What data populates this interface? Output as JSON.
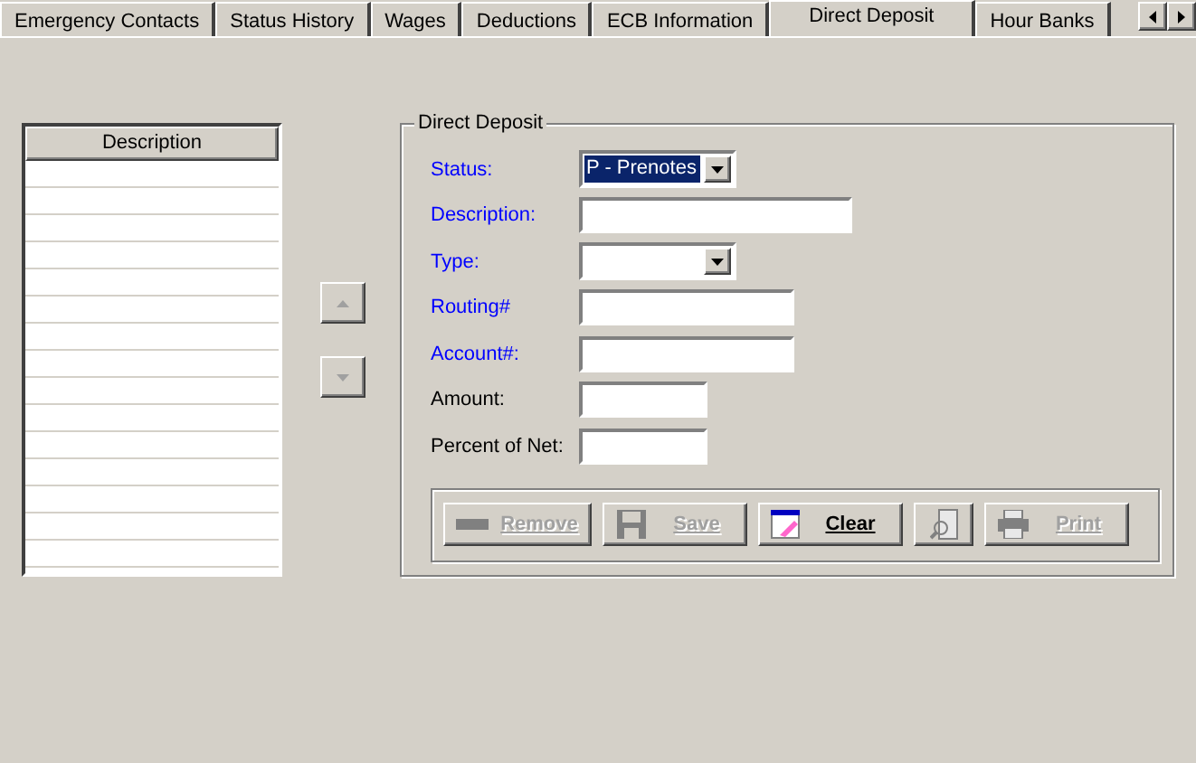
{
  "tabs": [
    {
      "label": "Emergency Contacts",
      "selected": false
    },
    {
      "label": "Status History",
      "selected": false
    },
    {
      "label": "Wages",
      "selected": false
    },
    {
      "label": "Deductions",
      "selected": false
    },
    {
      "label": "ECB Information",
      "selected": false
    },
    {
      "label": "Direct Deposit",
      "selected": true
    },
    {
      "label": "Hour Banks",
      "selected": false
    }
  ],
  "list": {
    "column": "Description"
  },
  "group": {
    "title": "Direct Deposit",
    "fields": [
      {
        "label": "Status:",
        "kind": "select",
        "required": true,
        "value": "P - Prenotes"
      },
      {
        "label": "Description:",
        "kind": "text",
        "required": true
      },
      {
        "label": "Type:",
        "kind": "select",
        "required": true
      },
      {
        "label": "Routing#",
        "kind": "text",
        "required": true
      },
      {
        "label": "Account#:",
        "kind": "text",
        "required": true
      },
      {
        "label": "Amount:",
        "kind": "text",
        "required": false
      },
      {
        "label": "Percent of Net:",
        "kind": "text",
        "required": false
      }
    ],
    "buttons": [
      {
        "kind": "remove",
        "label": "Remove",
        "disabled": true
      },
      {
        "kind": "save",
        "label": "Save",
        "disabled": true
      },
      {
        "kind": "clear",
        "label": "Clear",
        "disabled": false
      },
      {
        "kind": "preview",
        "disabled": true
      },
      {
        "kind": "print",
        "label": "Print",
        "disabled": true
      }
    ]
  }
}
